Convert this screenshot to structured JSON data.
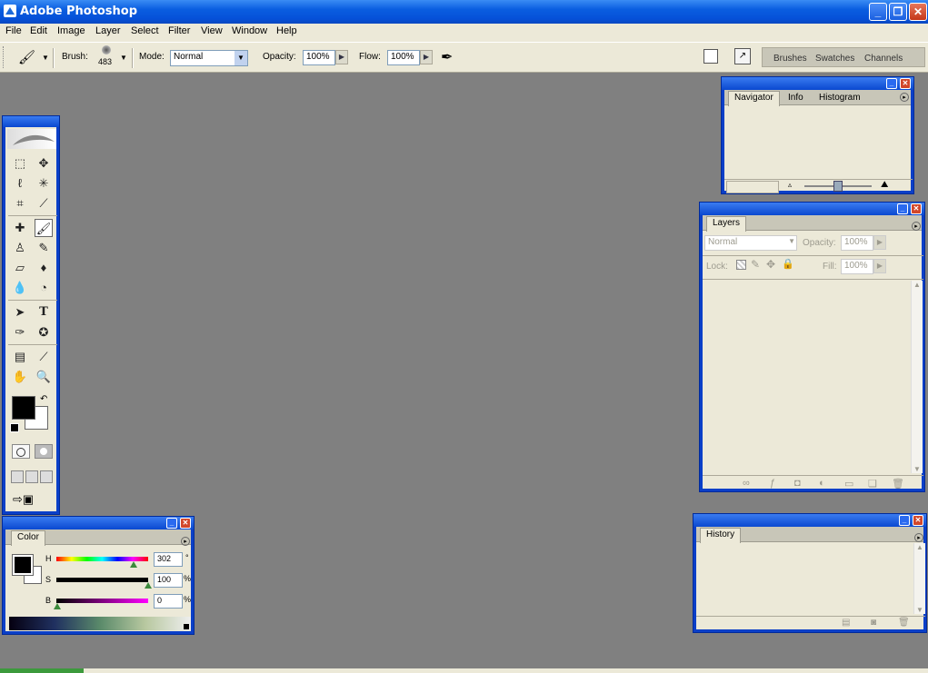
{
  "window": {
    "title": "Adobe Photoshop"
  },
  "menu": [
    "File",
    "Edit",
    "Image",
    "Layer",
    "Select",
    "Filter",
    "View",
    "Window",
    "Help"
  ],
  "options": {
    "brush_label": "Brush:",
    "brush_size": "483",
    "mode_label": "Mode:",
    "mode_value": "Normal",
    "opacity_label": "Opacity:",
    "opacity_value": "100%",
    "flow_label": "Flow:",
    "flow_value": "100%"
  },
  "palette_well": {
    "tabs": [
      "Brushes",
      "Swatches",
      "Channels"
    ]
  },
  "navigator": {
    "tabs": [
      "Navigator",
      "Info",
      "Histogram"
    ]
  },
  "layers": {
    "tab": "Layers",
    "blend_mode": "Normal",
    "opacity_label": "Opacity:",
    "opacity_value": "100%",
    "lock_label": "Lock:",
    "fill_label": "Fill:",
    "fill_value": "100%"
  },
  "history": {
    "tab": "History"
  },
  "color": {
    "tab": "Color",
    "h_label": "H",
    "h_value": "302",
    "h_unit": "°",
    "s_label": "S",
    "s_value": "100",
    "s_unit": "%",
    "b_label": "B",
    "b_value": "0",
    "b_unit": "%",
    "foreground": "#000000",
    "background": "#ffffff"
  },
  "icons": {
    "brush_tool": "paintbrush-icon",
    "marquee": "marquee-icon",
    "move": "move-icon",
    "lasso": "lasso-icon",
    "magic_wand": "magic-wand-icon",
    "crop": "crop-icon",
    "slice": "slice-icon"
  },
  "colors": {
    "canvas_bg": "#808080",
    "title_blue": "#0a5ee0",
    "panel_bg": "#ece9d8"
  }
}
